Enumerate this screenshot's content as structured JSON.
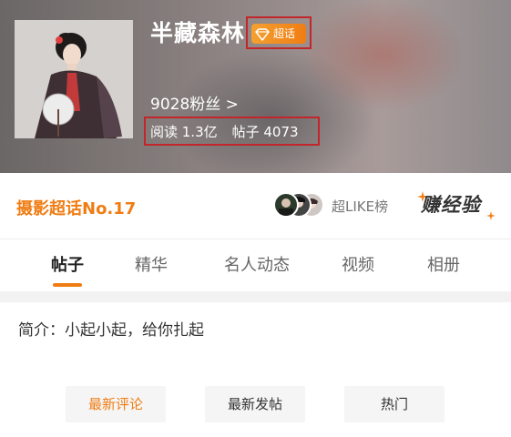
{
  "header": {
    "title": "半藏森林",
    "badge_label": "超话",
    "badge_icon": "diamond-icon",
    "fans": "9028粉丝 >",
    "stats": {
      "reads": "阅读 1.3亿",
      "posts": "帖子 4073"
    }
  },
  "card": {
    "rank": "摄影超话No.17",
    "like_label": "超LIKE榜",
    "earn_label": "赚经验"
  },
  "tabs": [
    {
      "label": "帖子",
      "active": true
    },
    {
      "label": "精华"
    },
    {
      "label": "名人动态"
    },
    {
      "label": "视频"
    },
    {
      "label": "相册"
    }
  ],
  "intro": "简介：小起小起，给你扎起",
  "filters": [
    {
      "label": "最新评论",
      "active": true
    },
    {
      "label": "最新发帖"
    },
    {
      "label": "热门"
    }
  ],
  "colors": {
    "accent": "#f07d14",
    "annotation_box": "#c2262b"
  }
}
